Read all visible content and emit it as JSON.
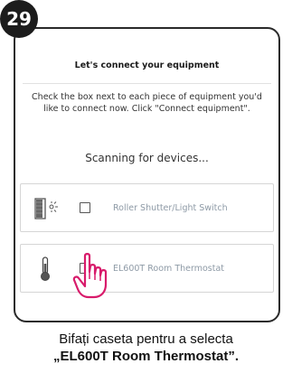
{
  "step": {
    "number": "29"
  },
  "screen": {
    "title": "Let's connect your equipment",
    "instructions": "Check the box next to each piece of equipment you'd like to connect now. Click \"Connect equipment\".",
    "scanning": "Scanning for devices..."
  },
  "devices": [
    {
      "label": "Roller Shutter/Light Switch",
      "icon": "shutter-light-switch-icon",
      "checked": false
    },
    {
      "label": "EL600T Room Thermostat",
      "icon": "thermometer-icon",
      "checked": false
    }
  ],
  "pointer": {
    "icon": "hand-pointer-icon",
    "color": "#d81b6b"
  },
  "caption": {
    "line1": "Bifați caseta pentru a selecta",
    "line2": "„EL600T Room Thermostat”."
  },
  "colors": {
    "accent": "#d81b6b",
    "frame": "#2a2a2a",
    "label_muted": "#8e9aa6"
  }
}
